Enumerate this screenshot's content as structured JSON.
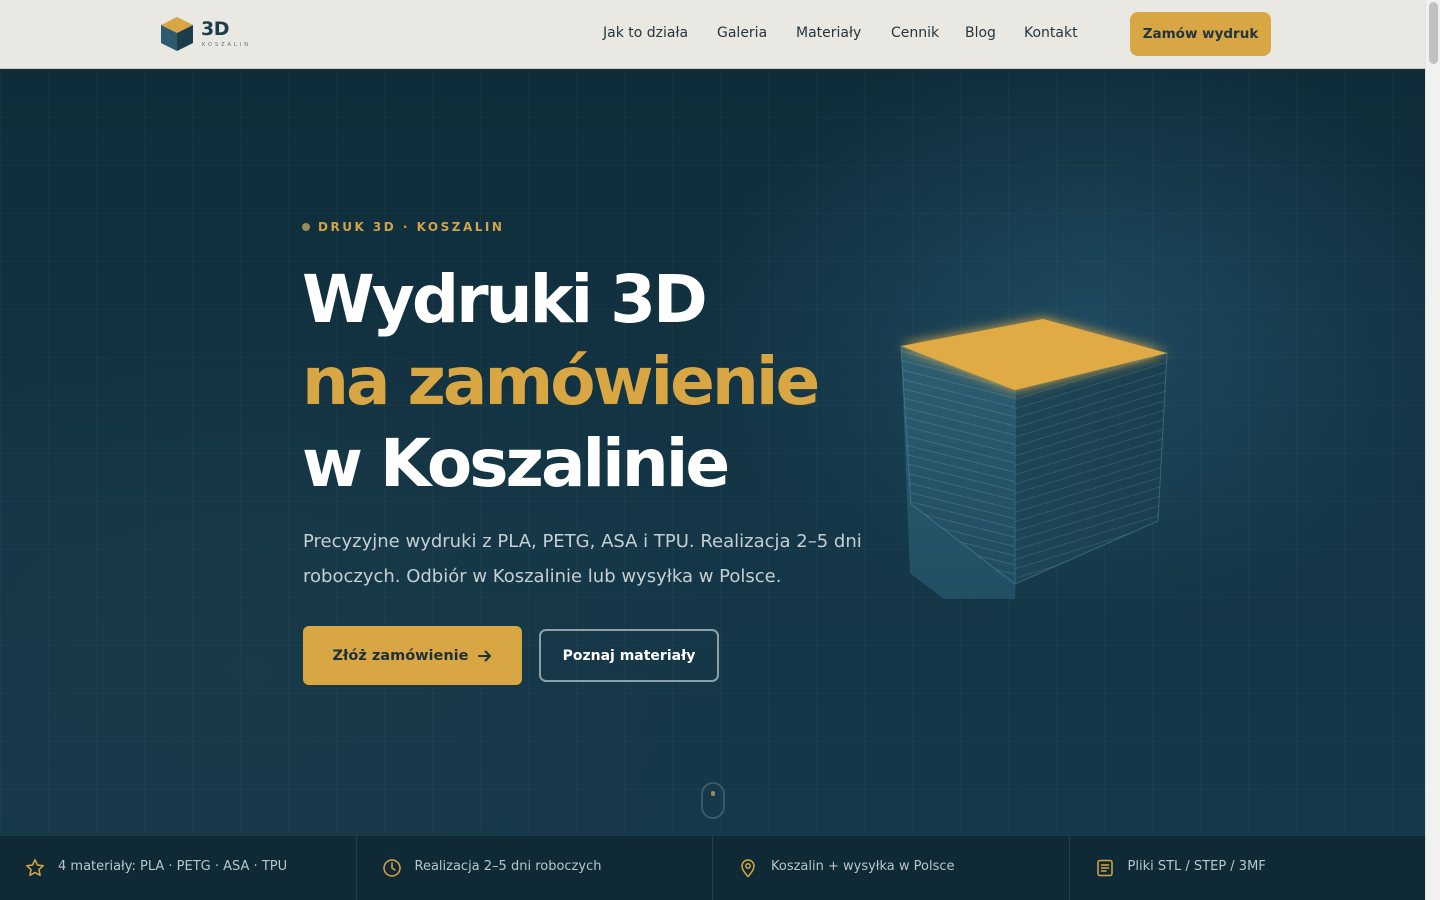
{
  "brand": {
    "logo_text": "3D",
    "logo_sub": "KOSZALIN",
    "colors": {
      "accent": "#d9a644",
      "dark": "#0e2a36",
      "header_bg": "#e9e8e2"
    }
  },
  "nav": {
    "items": [
      {
        "label": "Jak to działa"
      },
      {
        "label": "Galeria"
      },
      {
        "label": "Materiały"
      },
      {
        "label": "Cennik"
      },
      {
        "label": "Blog"
      },
      {
        "label": "Kontakt"
      }
    ],
    "cta_label": "Zamów wydruk"
  },
  "hero": {
    "eyebrow": "DRUK 3D · KOSZALIN",
    "headline": {
      "line1": "Wydruki 3D",
      "line2": "na zamówienie",
      "line3": "w Koszalinie"
    },
    "lead": "Precyzyjne wydruki z PLA, PETG, ASA i TPU. Realizacja 2–5 dni roboczych. Odbiór w Koszalinie lub wysyłka w Polsce.",
    "primary_button": "Złóż zamówienie",
    "primary_button_icon": "arrow-right-icon",
    "secondary_button": "Poznaj materiały",
    "illustration": "printed-cube"
  },
  "features": [
    {
      "icon": "star-icon",
      "text": "4 materiały: PLA · PETG · ASA · TPU"
    },
    {
      "icon": "clock-icon",
      "text": "Realizacja 2–5 dni roboczych"
    },
    {
      "icon": "location-pin-icon",
      "text": "Koszalin + wysyłka w Polsce"
    },
    {
      "icon": "file-icon",
      "text": "Pliki STL / STEP / 3MF"
    }
  ]
}
